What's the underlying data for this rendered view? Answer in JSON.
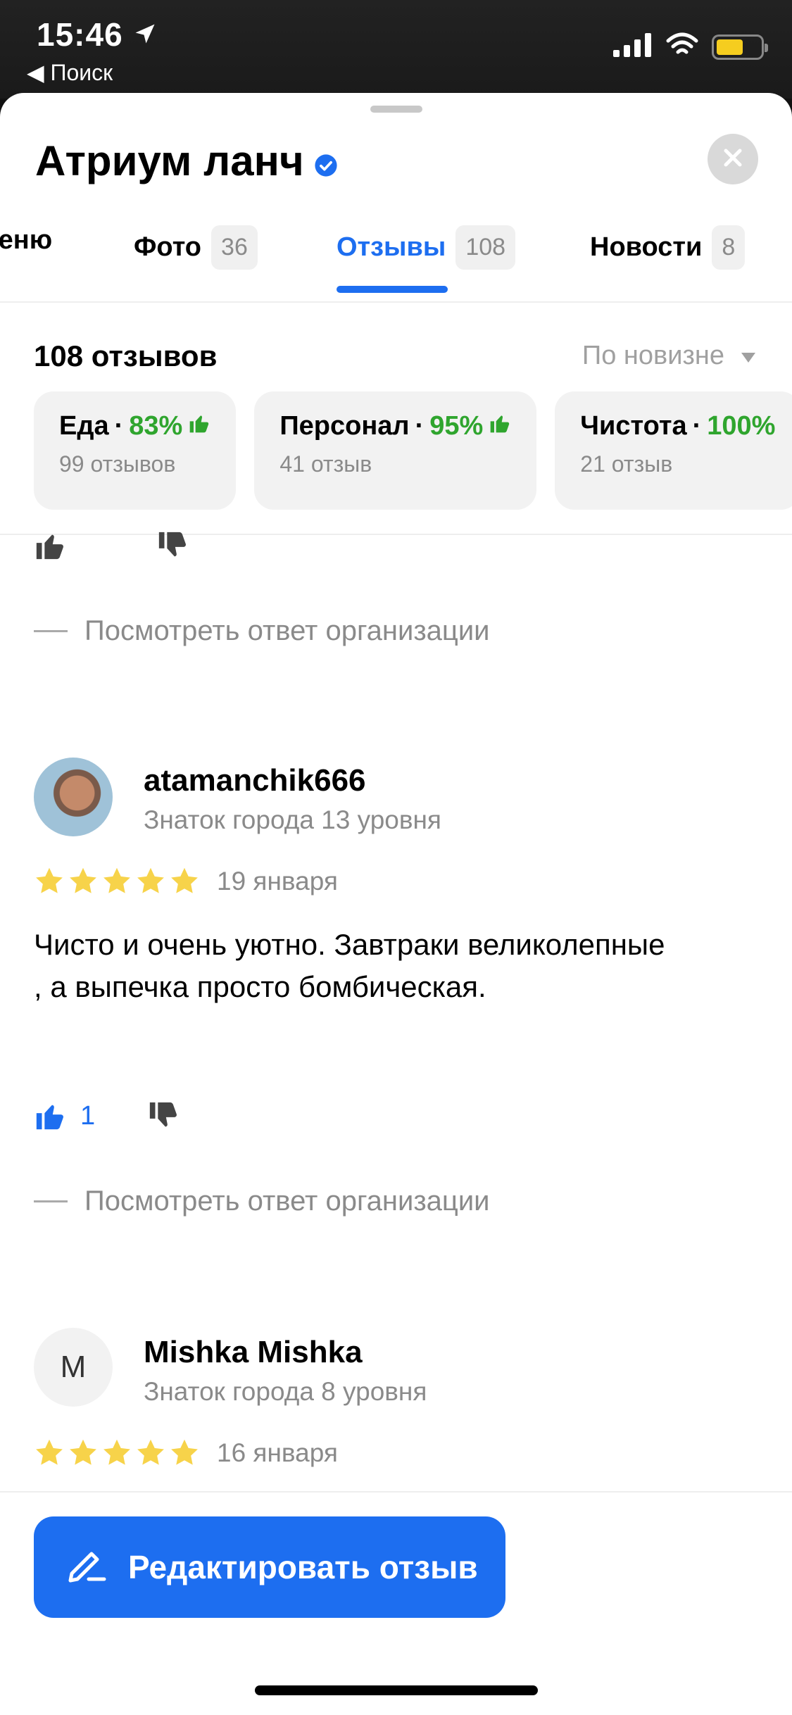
{
  "status_bar": {
    "time": "15:46",
    "back_label": "◀ Поиск",
    "battery_level": 0.62,
    "battery_color": "#f5cd1f"
  },
  "place": {
    "title": "Атриум ланч"
  },
  "tabs": [
    {
      "label": "Меню",
      "count": ""
    },
    {
      "label": "Фото",
      "count": "36"
    },
    {
      "label": "Отзывы",
      "count": "108",
      "active": true
    },
    {
      "label": "Новости",
      "count": "8"
    }
  ],
  "reviews_header": {
    "count_label": "108 отзывов",
    "sort_label": "По новизне"
  },
  "categories": [
    {
      "name": "Еда",
      "sep": "·",
      "percent": "83%",
      "count": "99 отзывов"
    },
    {
      "name": "Персонал",
      "sep": "·",
      "percent": "95%",
      "count": "41 отзыв"
    },
    {
      "name": "Чистота",
      "sep": "·",
      "percent": "100%",
      "count": "21 отзыв"
    }
  ],
  "prev_review": {
    "see_answer": "Посмотреть ответ организации"
  },
  "reviews": [
    {
      "author": "atamanchik666",
      "level": "Знаток города 13 уровня",
      "stars": 5,
      "date": "19 января",
      "text": "Чисто и очень уютно. Завтраки великолепные , а выпечка просто бомбическая.",
      "likes": "1",
      "see_answer": "Посмотреть ответ организации"
    },
    {
      "author": "Mishka Mishka",
      "avatar_letter": "M",
      "level": "Знаток города 8 уровня",
      "stars": 5,
      "date": "16 января"
    }
  ],
  "actions": {
    "edit_review": "Редактировать отзыв"
  },
  "colors": {
    "accent": "#1d6ef0",
    "positive": "#2fa52e",
    "star": "#f7d34a"
  }
}
